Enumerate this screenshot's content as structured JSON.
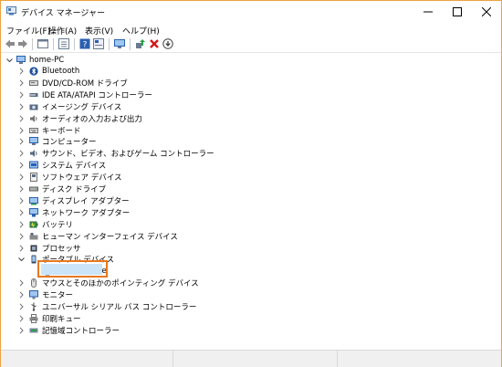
{
  "window": {
    "title": "デバイス マネージャー"
  },
  "menu": [
    "ファイル(F)",
    "操作(A)",
    "表示(V)",
    "ヘルプ(H)"
  ],
  "toolbar": {
    "icons": [
      "back-arrow-icon",
      "forward-arrow-icon",
      "properties-view-icon",
      "console-tree-icon",
      "help-icon",
      "device-view-icon",
      "monitor-icon",
      "update-driver-icon",
      "remove-device-icon",
      "download-icon"
    ]
  },
  "tree": {
    "root": "home-PC",
    "items": [
      {
        "label": "Bluetooth",
        "icon": "bluetooth-icon",
        "expanded": false
      },
      {
        "label": "DVD/CD-ROM ドライブ",
        "icon": "dvd-drive-icon",
        "expanded": false
      },
      {
        "label": "IDE ATA/ATAPI コントローラー",
        "icon": "ide-controller-icon",
        "expanded": false
      },
      {
        "label": "イメージング デバイス",
        "icon": "camera-icon",
        "expanded": false
      },
      {
        "label": "オーディオの入力および出力",
        "icon": "speaker-icon",
        "expanded": false
      },
      {
        "label": "キーボード",
        "icon": "keyboard-icon",
        "expanded": false
      },
      {
        "label": "コンピューター",
        "icon": "computer-icon",
        "expanded": false
      },
      {
        "label": "サウンド、ビデオ、およびゲーム コントローラー",
        "icon": "sound-icon",
        "expanded": false
      },
      {
        "label": "システム デバイス",
        "icon": "system-device-icon",
        "expanded": false
      },
      {
        "label": "ソフトウェア デバイス",
        "icon": "software-device-icon",
        "expanded": false
      },
      {
        "label": "ディスク ドライブ",
        "icon": "disk-drive-icon",
        "expanded": false
      },
      {
        "label": "ディスプレイ アダプター",
        "icon": "display-adapter-icon",
        "expanded": false
      },
      {
        "label": "ネットワーク アダプター",
        "icon": "network-adapter-icon",
        "expanded": false
      },
      {
        "label": "バッテリ",
        "icon": "battery-icon",
        "expanded": false
      },
      {
        "label": "ヒューマン インターフェイス デバイス",
        "icon": "hid-icon",
        "expanded": false
      },
      {
        "label": "プロセッサ",
        "icon": "processor-icon",
        "expanded": false
      },
      {
        "label": "ポータブル デバイス",
        "icon": "portable-device-icon",
        "expanded": true
      },
      {
        "label": "Apple iPhone",
        "icon": "iphone-icon",
        "child": true,
        "selected": true
      },
      {
        "label": "マウスとそのほかのポインティング デバイス",
        "icon": "mouse-icon",
        "expanded": false
      },
      {
        "label": "モニター",
        "icon": "monitor-icon",
        "expanded": false
      },
      {
        "label": "ユニバーサル シリアル バス コントローラー",
        "icon": "usb-icon",
        "expanded": false
      },
      {
        "label": "印刷キュー",
        "icon": "printer-icon",
        "expanded": false
      },
      {
        "label": "記憶域コントローラー",
        "icon": "storage-controller-icon",
        "expanded": false
      }
    ]
  },
  "colors": {
    "selection_border": "#e8781e",
    "selection_fill": "#cce4f7",
    "accent": "#2a6ebb"
  }
}
